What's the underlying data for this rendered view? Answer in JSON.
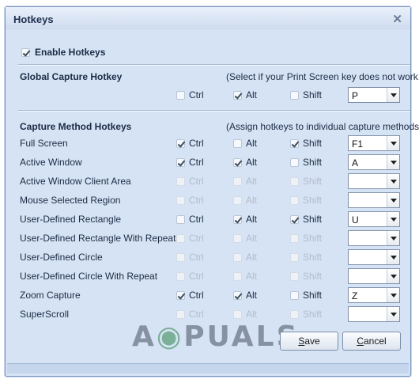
{
  "window": {
    "title": "Hotkeys"
  },
  "enable_hotkeys": {
    "label": "Enable Hotkeys",
    "checked": true
  },
  "global_capture": {
    "heading": "Global Capture Hotkey",
    "hint": "(Select if your Print Screen key does not work.)",
    "ctrl": {
      "label": "Ctrl",
      "checked": false
    },
    "alt": {
      "label": "Alt",
      "checked": true
    },
    "shift": {
      "label": "Shift",
      "checked": false
    },
    "key": "P"
  },
  "capture_methods": {
    "heading": "Capture Method Hotkeys",
    "hint": "(Assign hotkeys to individual capture methods.)",
    "mod_labels": {
      "ctrl": "Ctrl",
      "alt": "Alt",
      "shift": "Shift"
    },
    "rows": [
      {
        "name": "Full Screen",
        "enabled": true,
        "ctrl": true,
        "alt": false,
        "shift": true,
        "key": "F1"
      },
      {
        "name": "Active Window",
        "enabled": true,
        "ctrl": true,
        "alt": true,
        "shift": false,
        "key": "A"
      },
      {
        "name": "Active Window Client Area",
        "enabled": false,
        "ctrl": false,
        "alt": false,
        "shift": false,
        "key": ""
      },
      {
        "name": "Mouse Selected Region",
        "enabled": false,
        "ctrl": false,
        "alt": false,
        "shift": false,
        "key": ""
      },
      {
        "name": "User-Defined Rectangle",
        "enabled": true,
        "ctrl": false,
        "alt": true,
        "shift": true,
        "key": "U"
      },
      {
        "name": "User-Defined Rectangle With Repeat",
        "enabled": false,
        "ctrl": false,
        "alt": false,
        "shift": false,
        "key": ""
      },
      {
        "name": "User-Defined Circle",
        "enabled": false,
        "ctrl": false,
        "alt": false,
        "shift": false,
        "key": ""
      },
      {
        "name": "User-Defined Circle With Repeat",
        "enabled": false,
        "ctrl": false,
        "alt": false,
        "shift": false,
        "key": ""
      },
      {
        "name": "Zoom Capture",
        "enabled": true,
        "ctrl": true,
        "alt": true,
        "shift": false,
        "key": "Z"
      },
      {
        "name": "SuperScroll",
        "enabled": false,
        "ctrl": false,
        "alt": false,
        "shift": false,
        "key": ""
      }
    ]
  },
  "buttons": {
    "save_label": "Save",
    "cancel_label": "Cancel"
  },
  "watermark": "A PUALS"
}
